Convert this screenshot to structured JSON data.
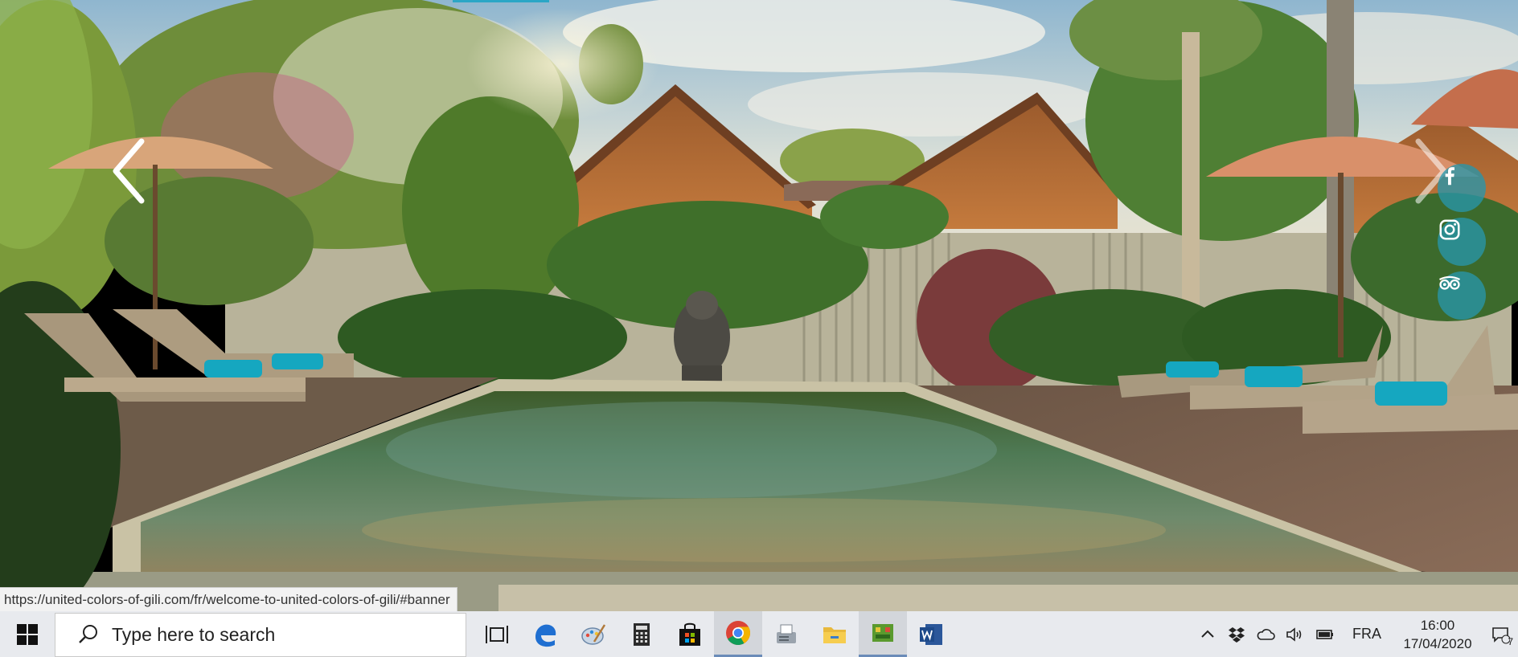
{
  "browser": {
    "status_url": "https://united-colors-of-gili.com/fr/welcome-to-united-colors-of-gili/#banner"
  },
  "hero": {
    "prev_icon": "chevron-left-icon",
    "next_icon": "chevron-right-icon",
    "social": [
      {
        "name": "facebook",
        "icon": "facebook-icon"
      },
      {
        "name": "instagram",
        "icon": "instagram-icon"
      },
      {
        "name": "tripadvisor",
        "icon": "tripadvisor-icon"
      }
    ],
    "accent_color": "#2896aa"
  },
  "taskbar": {
    "search_placeholder": "Type here to search",
    "apps": [
      {
        "name": "task-view",
        "icon": "task-view-icon"
      },
      {
        "name": "edge",
        "icon": "edge-icon"
      },
      {
        "name": "paint",
        "icon": "paint-icon"
      },
      {
        "name": "calculator",
        "icon": "calculator-icon"
      },
      {
        "name": "store",
        "icon": "store-icon"
      },
      {
        "name": "chrome",
        "icon": "chrome-icon",
        "active": true
      },
      {
        "name": "fax",
        "icon": "fax-icon"
      },
      {
        "name": "file-explorer",
        "icon": "folder-icon"
      },
      {
        "name": "app-green",
        "icon": "app-icon",
        "active": true
      },
      {
        "name": "word",
        "icon": "word-icon"
      }
    ],
    "tray": {
      "language": "FRA",
      "time": "16:00",
      "date": "17/04/2020",
      "notification_count": "7"
    }
  }
}
